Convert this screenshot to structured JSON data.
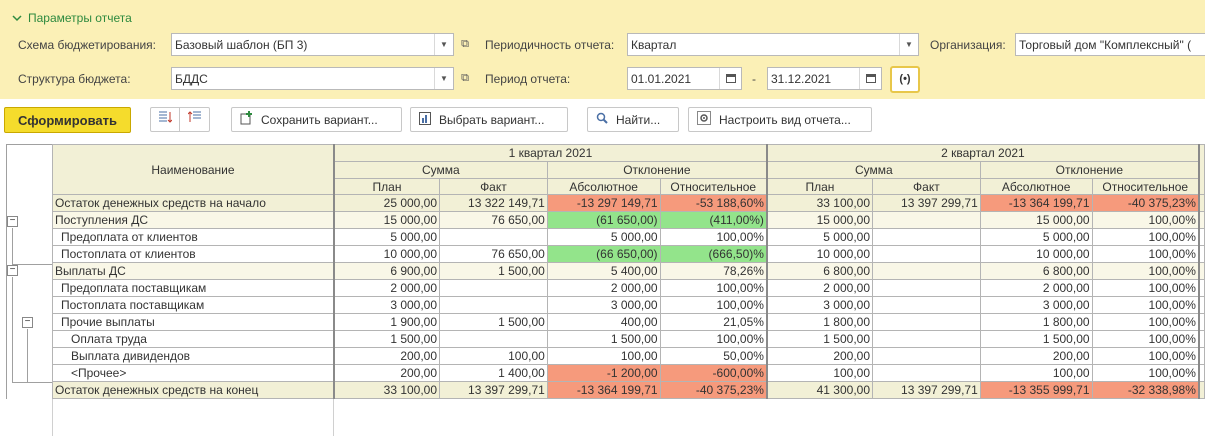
{
  "params": {
    "header": "Параметры отчета",
    "scheme_label": "Схема бюджетирования:",
    "scheme_value": "Базовый шаблон (БП 3)",
    "periodicity_label": "Периодичность отчета:",
    "periodicity_value": "Квартал",
    "org_label": "Организация:",
    "org_value": "Торговый дом \"Комплексный\" (",
    "structure_label": "Структура бюджета:",
    "structure_value": "БДДС",
    "period_label": "Период отчета:",
    "period_from": "01.01.2021",
    "period_dash": "-",
    "period_to": "31.12.2021",
    "period_btn": "(•)"
  },
  "toolbar": {
    "generate": "Сформировать",
    "save_variant": "Сохранить вариант...",
    "choose_variant": "Выбрать вариант...",
    "find": "Найти...",
    "configure": "Настроить вид отчета..."
  },
  "report": {
    "name_header": "Наименование",
    "q1": "1 квартал 2021",
    "q2": "2 квартал 2021",
    "sum": "Сумма",
    "deviation": "Отклонение",
    "plan": "План",
    "fact": "Факт",
    "absolute": "Абсолютное",
    "relative": "Относительное",
    "rows": [
      {
        "name": "Остаток денежных средств на начало",
        "q1_plan": "25 000,00",
        "q1_fact": "13 322 149,71",
        "q1_abs": "-13 297 149,71",
        "q1_rel": "-53 188,60%",
        "q2_plan": "33 100,00",
        "q2_fact": "13 397 299,71",
        "q2_abs": "-13 364 199,71",
        "q2_rel": "-40 375,23%"
      },
      {
        "name": "Поступления ДС",
        "q1_plan": "15 000,00",
        "q1_fact": "76 650,00",
        "q1_abs": "(61 650,00)",
        "q1_rel": "(411,00%)",
        "q2_plan": "15 000,00",
        "q2_fact": "",
        "q2_abs": "15 000,00",
        "q2_rel": "100,00%"
      },
      {
        "name": "Предоплата от клиентов",
        "q1_plan": "5 000,00",
        "q1_fact": "",
        "q1_abs": "5 000,00",
        "q1_rel": "100,00%",
        "q2_plan": "5 000,00",
        "q2_fact": "",
        "q2_abs": "5 000,00",
        "q2_rel": "100,00%"
      },
      {
        "name": "Постоплата от клиентов",
        "q1_plan": "10 000,00",
        "q1_fact": "76 650,00",
        "q1_abs": "(66 650,00)",
        "q1_rel": "(666,50)%",
        "q2_plan": "10 000,00",
        "q2_fact": "",
        "q2_abs": "10 000,00",
        "q2_rel": "100,00%"
      },
      {
        "name": "Выплаты ДС",
        "q1_plan": "6 900,00",
        "q1_fact": "1 500,00",
        "q1_abs": "5 400,00",
        "q1_rel": "78,26%",
        "q2_plan": "6 800,00",
        "q2_fact": "",
        "q2_abs": "6 800,00",
        "q2_rel": "100,00%"
      },
      {
        "name": "Предоплата поставщикам",
        "q1_plan": "2 000,00",
        "q1_fact": "",
        "q1_abs": "2 000,00",
        "q1_rel": "100,00%",
        "q2_plan": "2 000,00",
        "q2_fact": "",
        "q2_abs": "2 000,00",
        "q2_rel": "100,00%"
      },
      {
        "name": "Постоплата поставщикам",
        "q1_plan": "3 000,00",
        "q1_fact": "",
        "q1_abs": "3 000,00",
        "q1_rel": "100,00%",
        "q2_plan": "3 000,00",
        "q2_fact": "",
        "q2_abs": "3 000,00",
        "q2_rel": "100,00%"
      },
      {
        "name": "Прочие выплаты",
        "q1_plan": "1 900,00",
        "q1_fact": "1 500,00",
        "q1_abs": "400,00",
        "q1_rel": "21,05%",
        "q2_plan": "1 800,00",
        "q2_fact": "",
        "q2_abs": "1 800,00",
        "q2_rel": "100,00%"
      },
      {
        "name": "Оплата труда",
        "q1_plan": "1 500,00",
        "q1_fact": "",
        "q1_abs": "1 500,00",
        "q1_rel": "100,00%",
        "q2_plan": "1 500,00",
        "q2_fact": "",
        "q2_abs": "1 500,00",
        "q2_rel": "100,00%"
      },
      {
        "name": "Выплата дивидендов",
        "q1_plan": "200,00",
        "q1_fact": "100,00",
        "q1_abs": "100,00",
        "q1_rel": "50,00%",
        "q2_plan": "200,00",
        "q2_fact": "",
        "q2_abs": "200,00",
        "q2_rel": "100,00%"
      },
      {
        "name": "<Прочее>",
        "q1_plan": "200,00",
        "q1_fact": "1 400,00",
        "q1_abs": "-1 200,00",
        "q1_rel": "-600,00%",
        "q2_plan": "100,00",
        "q2_fact": "",
        "q2_abs": "100,00",
        "q2_rel": "100,00%"
      },
      {
        "name": "Остаток денежных средств на конец",
        "q1_plan": "33 100,00",
        "q1_fact": "13 397 299,71",
        "q1_abs": "-13 364 199,71",
        "q1_rel": "-40 375,23%",
        "q2_plan": "41 300,00",
        "q2_fact": "13 397 299,71",
        "q2_abs": "-13 355 999,71",
        "q2_rel": "-32 338,98%"
      }
    ]
  },
  "colors": {
    "panel_bg": "#fbf0b6",
    "primary_btn": "#f5dc2c",
    "negative_cell": "#f69a7c",
    "positive_cell": "#93e48b",
    "header_bg": "#f2f0d6",
    "link_green": "#2e8a3f"
  }
}
